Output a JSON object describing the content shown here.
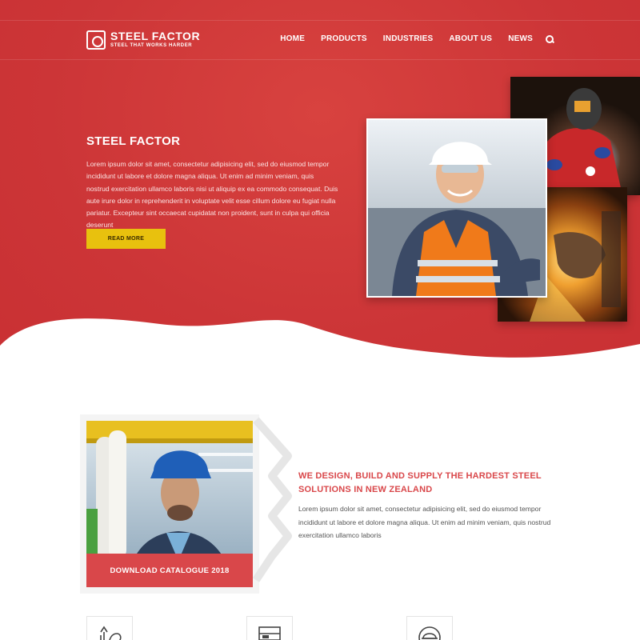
{
  "colors": {
    "brand_red": "#cc3537",
    "accent_yellow": "#e8c10e",
    "heading_red": "#d9474a"
  },
  "logo": {
    "name": "STEEL FACTOR",
    "tagline": "STEEL THAT WORKS HARDER"
  },
  "nav": {
    "items": [
      "HOME",
      "PRODUCTS",
      "INDUSTRIES",
      "ABOUT US",
      "NEWS"
    ],
    "search_icon": "search-icon"
  },
  "hero": {
    "title": "STEEL FACTOR",
    "text": "Lorem ipsum dolor sit amet, consectetur adipisicing elit, sed do eiusmod tempor incididunt ut labore et dolore magna aliqua. Ut enim ad minim veniam, quis nostrud exercitation ullamco laboris nisi ut aliquip ex ea commodo consequat. Duis aute irure dolor in reprehenderit in voluptate velit esse cillum dolore eu fugiat nulla pariatur. Excepteur sint occaecat cupidatat non proident, sunt in culpa qui officia deserunt",
    "button": "READ MORE"
  },
  "catalogue": {
    "button": "DOWNLOAD CATALOGUE 2018"
  },
  "about": {
    "heading": "WE DESIGN, BUILD AND SUPPLY THE HARDEST STEEL SOLUTIONS IN NEW ZEALAND",
    "text": "Lorem ipsum dolor sit amet, consectetur adipisicing elit, sed do eiusmod tempor incididunt ut labore et dolore magna aliqua. Ut enim ad minim veniam, quis nostrud exercitation ullamco laboris"
  },
  "features": {
    "icons": [
      "strength-arm-icon",
      "steel-panel-icon",
      "worker-helmet-icon"
    ]
  }
}
